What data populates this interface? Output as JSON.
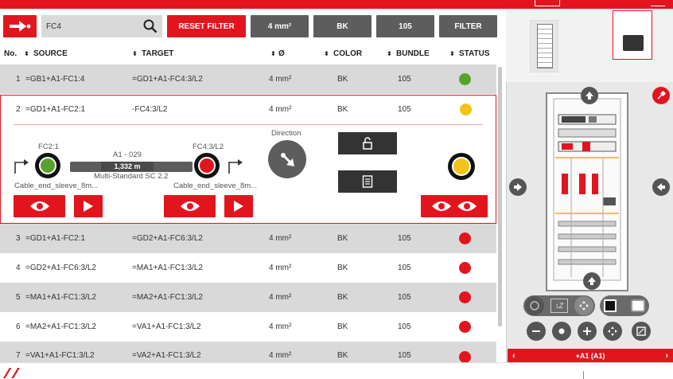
{
  "filters": {
    "search_value": "FC4",
    "reset_label": "RESET FILTER",
    "size_label": "4 mm²",
    "color_label": "BK",
    "bundle_label": "105",
    "filter_label": "FILTER"
  },
  "columns": {
    "no": "No.",
    "source": "SOURCE",
    "target": "TARGET",
    "diameter": "Ø",
    "color": "COLOR",
    "bundle": "BUNDLE",
    "status": "STATUS"
  },
  "rows": [
    {
      "no": "1",
      "source": "=GB1+A1-FC1:4",
      "target": "=GD1+A1-FC4:3/L2",
      "size": "4 mm²",
      "color": "BK",
      "bundle": "105",
      "status_color": "#5aa02c"
    },
    {
      "no": "2",
      "source": "=GD1+A1-FC2:1",
      "target": "-FC4:3/L2",
      "size": "4 mm²",
      "color": "BK",
      "bundle": "105",
      "status_color": "#f2c318"
    },
    {
      "no": "3",
      "source": "=GD1+A1-FC2:1",
      "target": "=GD2+A1-FC6:3/L2",
      "size": "4 mm²",
      "color": "BK",
      "bundle": "105",
      "status_color": "#e2151f"
    },
    {
      "no": "4",
      "source": "=GD2+A1-FC6:3/L2",
      "target": "=MA1+A1-FC1:3/L2",
      "size": "4 mm²",
      "color": "BK",
      "bundle": "105",
      "status_color": "#e2151f"
    },
    {
      "no": "5",
      "source": "=MA1+A1-FC1:3/L2",
      "target": "=MA2+A1-FC1:3/L2",
      "size": "4 mm²",
      "color": "BK",
      "bundle": "105",
      "status_color": "#e2151f"
    },
    {
      "no": "6",
      "source": "=MA2+A1-FC1:3/L2",
      "target": "=VA1+A1-FC1:3/L2",
      "size": "4 mm²",
      "color": "BK",
      "bundle": "105",
      "status_color": "#e2151f"
    },
    {
      "no": "7",
      "source": "=VA1+A1-FC1:3/L2",
      "target": "=VA2+A1-FC1:3/L2",
      "size": "4 mm²",
      "color": "BK",
      "bundle": "105",
      "status_color": "#e2151f"
    }
  ],
  "detail": {
    "source_device": "FC2:1",
    "target_device": "FC4:3/L2",
    "cable_name": "A1 - 029",
    "cable_length": "1,332 m",
    "cable_type": "Multi-Standard SC 2.2",
    "source_end": "Cable_end_sleeve_8m...",
    "target_end": "Cable_end_sleeve_8m...",
    "direction_label": "Direction",
    "source_status_color": "#5aa02c",
    "target_status_color": "#e2151f",
    "overall_status_color": "#f2c318"
  },
  "viewer": {
    "location_label": "+A1 (A1)"
  },
  "colors": {
    "brand": "#e2151f",
    "dark": "#5d5d5d"
  }
}
